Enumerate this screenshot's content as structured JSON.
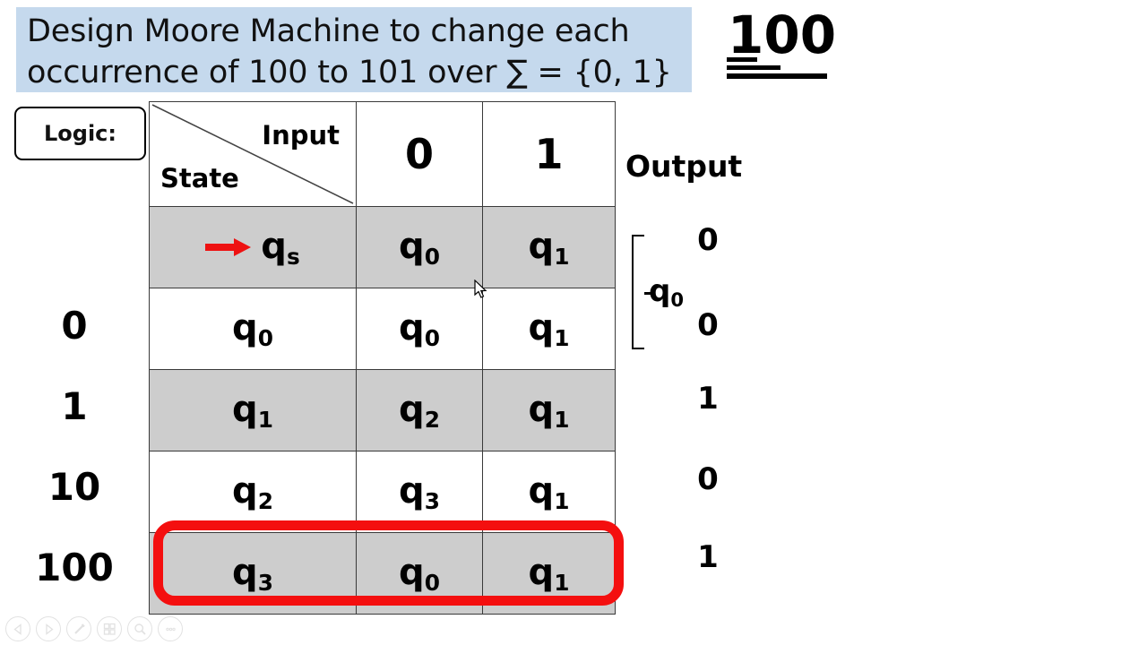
{
  "slide": {
    "title_lines": [
      "Design Moore Machine to change each",
      "occurrence of 100 to 101 over ∑ = {0, 1}"
    ],
    "banner_color": "#c5d9ed",
    "annotation": {
      "value": "100",
      "underline_count": 3
    },
    "logic_label": "Logic:"
  },
  "table": {
    "corner": {
      "input_label": "Input",
      "state_label": "State"
    },
    "input_columns": [
      "0",
      "1"
    ],
    "row_labels": [
      "",
      "0",
      "1",
      "10",
      "100"
    ],
    "rows": [
      {
        "state": "q",
        "state_sub": "s",
        "start": true,
        "shaded": true,
        "on0": "q",
        "on0_sub": "0",
        "on1": "q",
        "on1_sub": "1",
        "output": "0",
        "highlighted": false
      },
      {
        "state": "q",
        "state_sub": "0",
        "start": false,
        "shaded": false,
        "on0": "q",
        "on0_sub": "0",
        "on1": "q",
        "on1_sub": "1",
        "output": "0",
        "highlighted": false
      },
      {
        "state": "q",
        "state_sub": "1",
        "start": false,
        "shaded": true,
        "on0": "q",
        "on0_sub": "2",
        "on1": "q",
        "on1_sub": "1",
        "output": "1",
        "highlighted": false
      },
      {
        "state": "q",
        "state_sub": "2",
        "start": false,
        "shaded": false,
        "on0": "q",
        "on0_sub": "3",
        "on1": "q",
        "on1_sub": "1",
        "output": "0",
        "highlighted": false
      },
      {
        "state": "q",
        "state_sub": "3",
        "start": false,
        "shaded": true,
        "on0": "q",
        "on0_sub": "0",
        "on1": "q",
        "on1_sub": "1",
        "output": "1",
        "highlighted": true
      }
    ],
    "highlight_color": "#f40f0f",
    "shade_color": "#cdcdcd",
    "start_arrow_color": "#ee1111"
  },
  "output": {
    "title": "Output",
    "group_label": "q",
    "group_label_sub": "0"
  },
  "toolbar": {
    "buttons": [
      {
        "name": "previous-slide-button",
        "icon": "triangle-left-icon"
      },
      {
        "name": "next-slide-button",
        "icon": "triangle-right-icon"
      },
      {
        "name": "pen-tool-button",
        "icon": "pen-icon"
      },
      {
        "name": "all-slides-button",
        "icon": "grid-slides-icon"
      },
      {
        "name": "zoom-button",
        "icon": "magnifier-icon"
      },
      {
        "name": "more-options-button",
        "icon": "ellipsis-icon"
      }
    ]
  }
}
